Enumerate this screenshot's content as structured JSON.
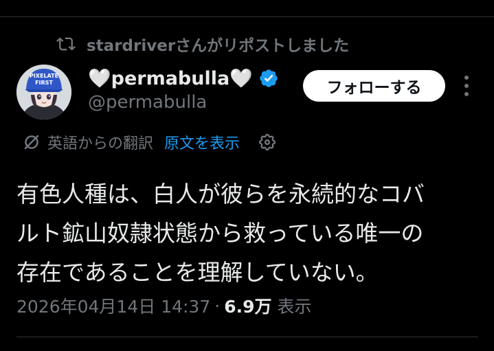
{
  "repost": {
    "text": "stardriverさんがリポストしました",
    "icon": "repost-icon"
  },
  "author": {
    "display_name": "🤍permabulla🤍",
    "handle": "@permabulla",
    "verified": true,
    "verified_color": "#1d9bf0",
    "avatar_cap_text": [
      "PIXELATE",
      "FIRST"
    ]
  },
  "follow_button": {
    "label": "フォローする"
  },
  "translation": {
    "label": "英語からの翻訳",
    "original_link": "原文を表示",
    "link_color": "#1d9bf0",
    "icon": "translate-icon",
    "settings_icon": "gear-icon"
  },
  "tweet": {
    "lines": [
      "有色人種は、白人が彼らを永続的なコバ",
      "ルト鉱山奴隷状態から救っている唯一の",
      "存在であることを理解していない。"
    ]
  },
  "meta": {
    "timestamp": "2026年04月14日 14:37",
    "separator": "·",
    "views_count": "6.9万",
    "views_label": "表示"
  }
}
